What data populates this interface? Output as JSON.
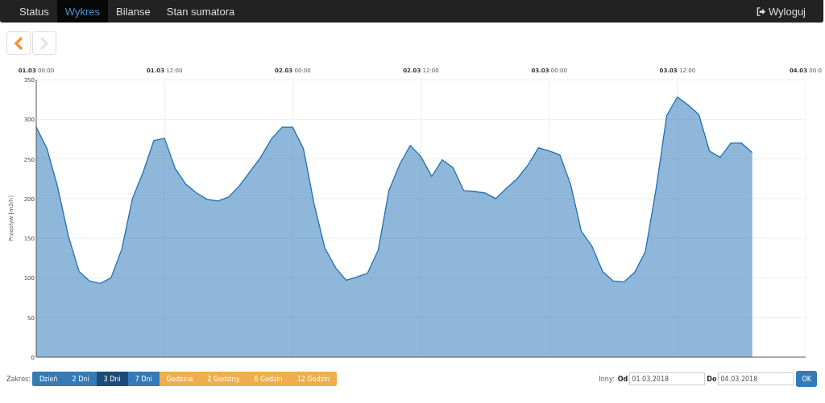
{
  "navbar": {
    "items": [
      {
        "label": "Status",
        "selected": false
      },
      {
        "label": "Wykres",
        "selected": true
      },
      {
        "label": "Bilanse",
        "selected": false
      },
      {
        "label": "Stan sumatora",
        "selected": false
      }
    ],
    "logout": "Wyloguj"
  },
  "pager": {
    "previous": {
      "disabled": false
    },
    "next": {
      "disabled": true
    }
  },
  "chart": {
    "chart_data": {
      "type": "area",
      "grid": true,
      "ylabel": "Przepływ [m3/h]",
      "ylim": [
        0,
        350
      ],
      "categories": [
        "01.03 00:00",
        null,
        null,
        null,
        null,
        null,
        null,
        null,
        null,
        null,
        null,
        null,
        "01.03 12:00",
        null,
        null,
        null,
        null,
        null,
        null,
        null,
        null,
        null,
        null,
        null,
        "02.03 00:00",
        null,
        null,
        null,
        null,
        null,
        null,
        null,
        null,
        null,
        null,
        null,
        "02.03 12:00",
        null,
        null,
        null,
        null,
        null,
        null,
        null,
        null,
        null,
        null,
        null,
        "03.03 00:00",
        null,
        null,
        null,
        null,
        null,
        null,
        null,
        null,
        null,
        null,
        null,
        "03.03 12:00",
        null,
        null,
        null,
        null,
        null,
        null,
        null,
        null,
        null,
        null,
        null,
        "04.03 00:0"
      ],
      "yticks": [
        0,
        50,
        100,
        150,
        200,
        250,
        300,
        350
      ],
      "series": [
        {
          "color": "#1f6fb4",
          "values": [
            290,
            263,
            215,
            153,
            108,
            96,
            93,
            100,
            136,
            200,
            233,
            273,
            276,
            238,
            218,
            207,
            199,
            197,
            202,
            216,
            234,
            252,
            275,
            290,
            290,
            263,
            193,
            138,
            113,
            97,
            101,
            106,
            135,
            210,
            243,
            267,
            253,
            228,
            249,
            239,
            210,
            209,
            207,
            200,
            213,
            225,
            242,
            264,
            260,
            255,
            218,
            159,
            140,
            108,
            96,
            95,
            107,
            133,
            212,
            305,
            328,
            318,
            306,
            260,
            252,
            270,
            270,
            258,
            null,
            null,
            null,
            null,
            null
          ]
        }
      ]
    }
  },
  "range": {
    "label": "Zakres:",
    "buttons": [
      {
        "label": "Dzień",
        "kind": "days",
        "selected": false
      },
      {
        "label": "2 Dni",
        "kind": "days",
        "selected": false
      },
      {
        "label": "3 Dni",
        "kind": "days",
        "selected": true
      },
      {
        "label": "7 Dni",
        "kind": "days",
        "selected": false
      },
      {
        "label": "Godzina",
        "kind": "hours",
        "selected": false
      },
      {
        "label": "2 Godziny",
        "kind": "hours",
        "selected": false
      },
      {
        "label": "6 Godzin",
        "kind": "hours",
        "selected": false
      },
      {
        "label": "12 Godzin",
        "kind": "hours",
        "selected": false
      }
    ]
  },
  "custom": {
    "label": "Inny:",
    "from_label": "Od",
    "from": "01.03.2018",
    "to_label": "Do",
    "to": "04.03.2018",
    "ok": "OK"
  }
}
